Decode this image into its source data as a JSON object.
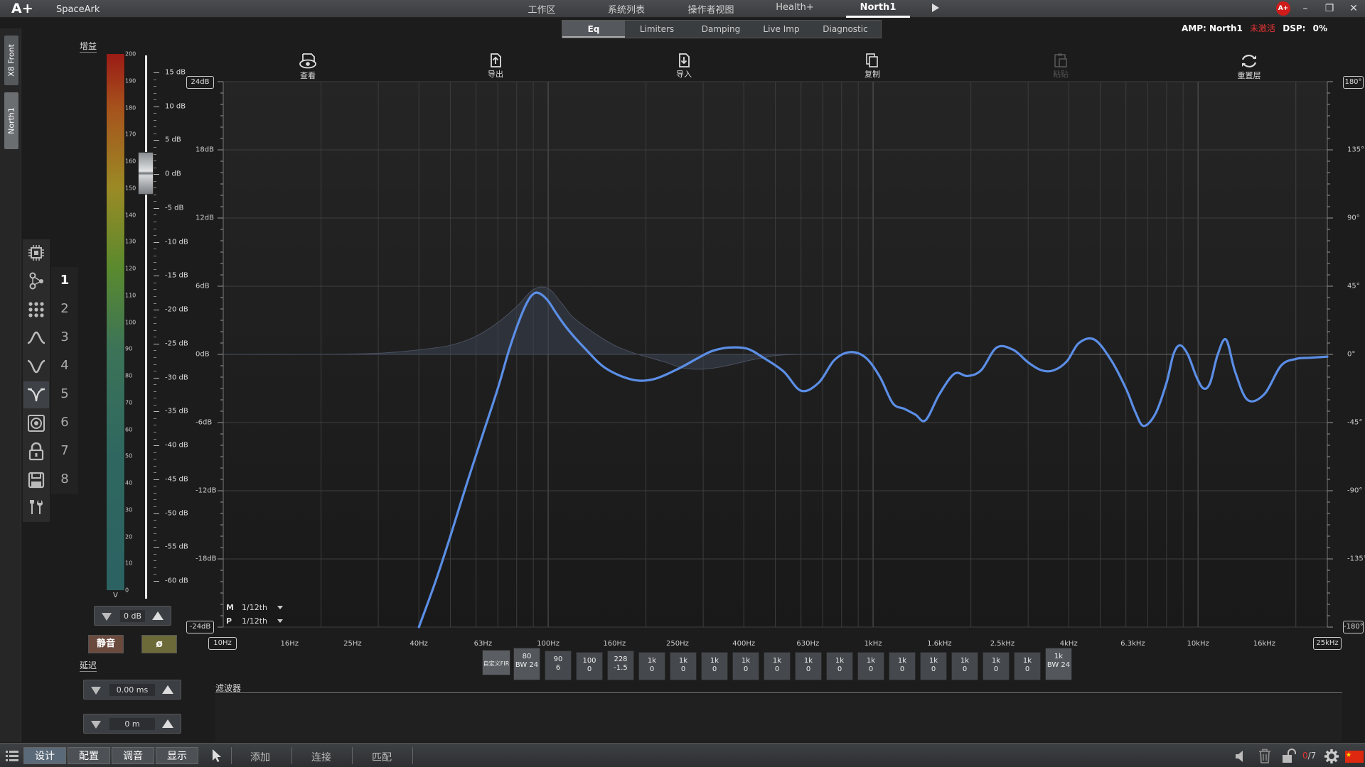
{
  "titlebar": {
    "logo": "A+",
    "project": "SpaceArk",
    "tabs": [
      "工作区",
      "系统列表",
      "操作者视图",
      "Health+",
      "North1"
    ],
    "active_tab": "North1",
    "badge": "A+",
    "minimize": "–",
    "restore": "❐",
    "close": "✕"
  },
  "subtabs": {
    "items": [
      "Eq",
      "Limiters",
      "Damping",
      "Live Imp",
      "Diagnostic"
    ],
    "active": "Eq"
  },
  "amp_info": {
    "amp_label": "AMP:",
    "amp_name": "North1",
    "status": "未激活",
    "dsp_label": "DSP:",
    "dsp_value": "0%"
  },
  "vertical_tabs": [
    "X8 Front",
    "North1"
  ],
  "gain_panel": {
    "label": "增益",
    "meter_ticks": [
      "200",
      "190",
      "180",
      "170",
      "160",
      "150",
      "140",
      "130",
      "120",
      "110",
      "100",
      "90",
      "80",
      "70",
      "60",
      "50",
      "40",
      "30",
      "20",
      "10",
      "0"
    ],
    "meter_unit": "V",
    "scale_labels": [
      "15 dB",
      "10 dB",
      "5 dB",
      "0 dB",
      "-5 dB",
      "-10 dB",
      "-15 dB",
      "-20 dB",
      "-25 dB",
      "-30 dB",
      "-35 dB",
      "-40 dB",
      "-45 dB",
      "-50 dB",
      "-55 dB",
      "-60 dB"
    ],
    "fader_value_db": 0,
    "gain_value": "0 dB",
    "mute": "静音",
    "phase": "ø"
  },
  "delay_panel": {
    "label": "延迟",
    "time_value": "0.00 ms",
    "distance_value": "0 m"
  },
  "icon_toolbar": [
    "chip-icon",
    "routing-icon",
    "matrix-icon",
    "peak-filter-icon",
    "notch-filter-icon",
    "crossover-icon",
    "speaker-icon",
    "lock-icon",
    "save-icon",
    "tools-icon"
  ],
  "channel_numbers": [
    "1",
    "2",
    "3",
    "4",
    "5",
    "6",
    "7",
    "8"
  ],
  "active_channel": "1",
  "tools": [
    {
      "label": "查看",
      "icon": "view-icon",
      "enabled": true
    },
    {
      "label": "导出",
      "icon": "export-icon",
      "enabled": true
    },
    {
      "label": "导入",
      "icon": "import-icon",
      "enabled": true
    },
    {
      "label": "复制",
      "icon": "copy-icon",
      "enabled": true
    },
    {
      "label": "粘贴",
      "icon": "paste-icon",
      "enabled": false
    },
    {
      "label": "重置层",
      "icon": "reset-icon",
      "enabled": true
    }
  ],
  "chart_data": {
    "type": "line",
    "x_scale": "log",
    "xlim": [
      10,
      25000
    ],
    "ylim": [
      -24,
      24
    ],
    "phase_lim": [
      -180,
      180
    ],
    "grid": true,
    "y_ticks": [
      "24dB",
      "18dB",
      "12dB",
      "6dB",
      "0dB",
      "-6dB",
      "-12dB",
      "-18dB",
      "-24dB"
    ],
    "phase_ticks": [
      "180°",
      "135°",
      "90°",
      "45°",
      "0°",
      "-45°",
      "-90°",
      "-135°",
      "-180°"
    ],
    "x_ticks": [
      "10Hz",
      "16Hz",
      "25Hz",
      "40Hz",
      "63Hz",
      "100Hz",
      "160Hz",
      "250Hz",
      "400Hz",
      "630Hz",
      "1kHz",
      "1.6kHz",
      "2.5kHz",
      "4kHz",
      "6.3kHz",
      "10kHz",
      "16kHz",
      "25kHz"
    ],
    "series": [
      {
        "color": "#5b8ee6",
        "x": [
          40,
          45,
          50,
          56,
          63,
          70,
          76,
          82,
          87,
          91,
          95,
          100,
          106,
          115,
          130,
          150,
          180,
          210,
          250,
          290,
          320,
          360,
          410,
          460,
          530,
          600,
          680,
          760,
          850,
          950,
          1050,
          1150,
          1250,
          1350,
          1450,
          1600,
          1780,
          1950,
          2150,
          2400,
          2700,
          3000,
          3300,
          3600,
          3950,
          4300,
          4800,
          5400,
          6000,
          6400,
          6800,
          7400,
          8000,
          8400,
          8800,
          9300,
          9900,
          10400,
          10900,
          11500,
          12200,
          13000,
          14200,
          16000,
          18000,
          20000,
          22000,
          25000
        ],
        "y": [
          -24,
          -20,
          -16,
          -11.5,
          -7,
          -3,
          0.5,
          3.2,
          4.8,
          5.4,
          5.3,
          4.7,
          3.6,
          2.2,
          0.5,
          -1.2,
          -2.2,
          -2.2,
          -1.3,
          -0.3,
          0.3,
          0.6,
          0.5,
          -0.3,
          -1.5,
          -3.2,
          -2.5,
          -0.5,
          0.2,
          -0.3,
          -2.0,
          -4.3,
          -4.8,
          -5.3,
          -5.8,
          -3.5,
          -1.7,
          -1.9,
          -1.4,
          0.6,
          0.4,
          -0.7,
          -1.4,
          -1.4,
          -0.6,
          1.0,
          1.3,
          -0.5,
          -3.0,
          -5.0,
          -6.3,
          -5.2,
          -2.5,
          0.0,
          0.8,
          0.0,
          -2.0,
          -3.0,
          -2.5,
          0.0,
          1.3,
          -1.5,
          -4.0,
          -3.5,
          -1.0,
          -0.4,
          -0.3,
          -0.2
        ]
      },
      {
        "color": "#4a5060",
        "x": [
          10,
          20,
          30,
          40,
          50,
          60,
          70,
          80,
          90,
          100,
          110,
          120,
          140,
          160,
          180,
          200,
          230,
          260,
          300,
          340,
          380,
          420,
          460,
          500,
          600,
          1000
        ],
        "y": [
          0,
          0,
          0.1,
          0.4,
          0.8,
          1.6,
          2.8,
          4.2,
          5.7,
          5.8,
          4.5,
          3.2,
          1.8,
          0.8,
          0.2,
          -0.2,
          -0.7,
          -1.2,
          -1.3,
          -1.1,
          -0.8,
          -0.5,
          -0.3,
          -0.1,
          0,
          0
        ],
        "shaded": true
      }
    ]
  },
  "edge_boxes": {
    "y_top": "24dB",
    "y_bottom": "-24dB",
    "x_left": "10Hz",
    "x_right": "25kHz",
    "phase_top": "180°",
    "phase_bottom": "-180°"
  },
  "resolution": {
    "m_label": "M",
    "m_value": "1/12th",
    "p_label": "P",
    "p_value": "1/12th"
  },
  "filter_buttons": [
    {
      "line1": "自定义FIR",
      "line2": ""
    },
    {
      "line1": "80",
      "line2": "BW 24"
    },
    {
      "line1": "90",
      "line2": "6"
    },
    {
      "line1": "100",
      "line2": "0"
    },
    {
      "line1": "228",
      "line2": "-1.5"
    },
    {
      "line1": "1k",
      "line2": "0"
    },
    {
      "line1": "1k",
      "line2": "0"
    },
    {
      "line1": "1k",
      "line2": "0"
    },
    {
      "line1": "1k",
      "line2": "0"
    },
    {
      "line1": "1k",
      "line2": "0"
    },
    {
      "line1": "1k",
      "line2": "0"
    },
    {
      "line1": "1k",
      "line2": "0"
    },
    {
      "line1": "1k",
      "line2": "0"
    },
    {
      "line1": "1k",
      "line2": "0"
    },
    {
      "line1": "1k",
      "line2": "0"
    },
    {
      "line1": "1k",
      "line2": "0"
    },
    {
      "line1": "1k",
      "line2": "0"
    },
    {
      "line1": "1k",
      "line2": "0"
    },
    {
      "line1": "1k",
      "line2": "BW 24"
    }
  ],
  "filter_section": {
    "label": "滤波器"
  },
  "bottombar": {
    "tabs": [
      "设计",
      "配置",
      "调音",
      "显示"
    ],
    "active_tab": "设计",
    "actions": [
      "添加",
      "连接",
      "匹配"
    ],
    "count_current": "0",
    "count_total": "/7"
  }
}
